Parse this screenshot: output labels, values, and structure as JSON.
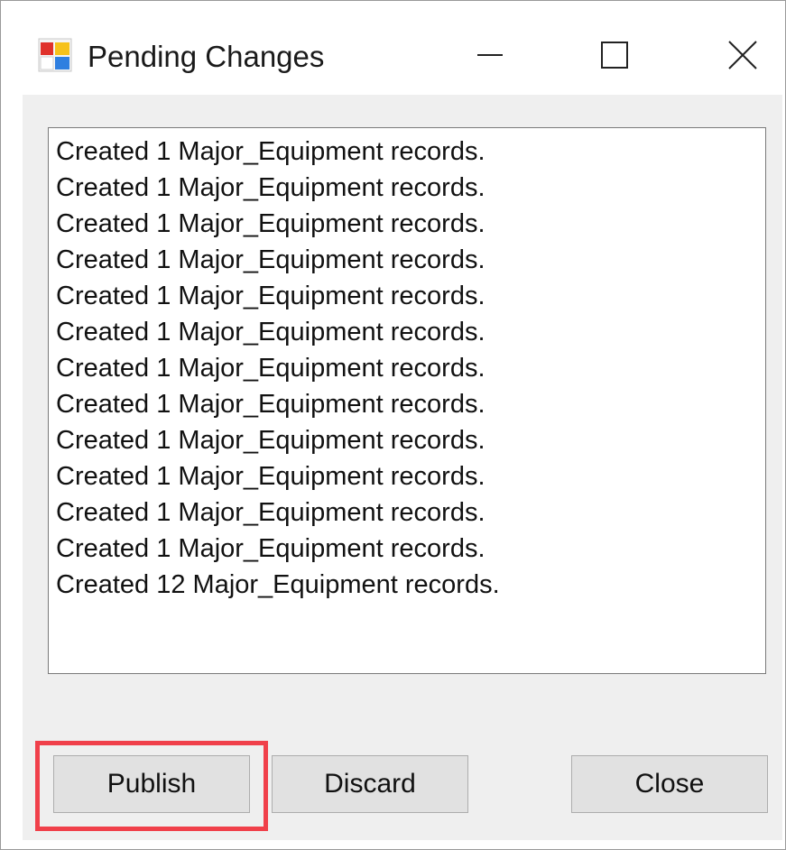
{
  "window": {
    "title": "Pending Changes"
  },
  "icons": {
    "app": "app-form-icon",
    "minimize": "minimize-icon",
    "maximize": "maximize-icon",
    "close": "close-icon"
  },
  "list": {
    "items": [
      "Created 1 Major_Equipment records.",
      "Created 1 Major_Equipment records.",
      "Created 1 Major_Equipment records.",
      "Created 1 Major_Equipment records.",
      "Created 1 Major_Equipment records.",
      "Created 1 Major_Equipment records.",
      "Created 1 Major_Equipment records.",
      "Created 1 Major_Equipment records.",
      "Created 1 Major_Equipment records.",
      "Created 1 Major_Equipment records.",
      "Created 1 Major_Equipment records.",
      "Created 1 Major_Equipment records.",
      "Created 12 Major_Equipment records."
    ]
  },
  "buttons": {
    "publish": "Publish",
    "discard": "Discard",
    "close": "Close"
  },
  "colors": {
    "highlight": "#f0404a",
    "client_background": "#efefef",
    "button_background": "#e1e1e1"
  }
}
